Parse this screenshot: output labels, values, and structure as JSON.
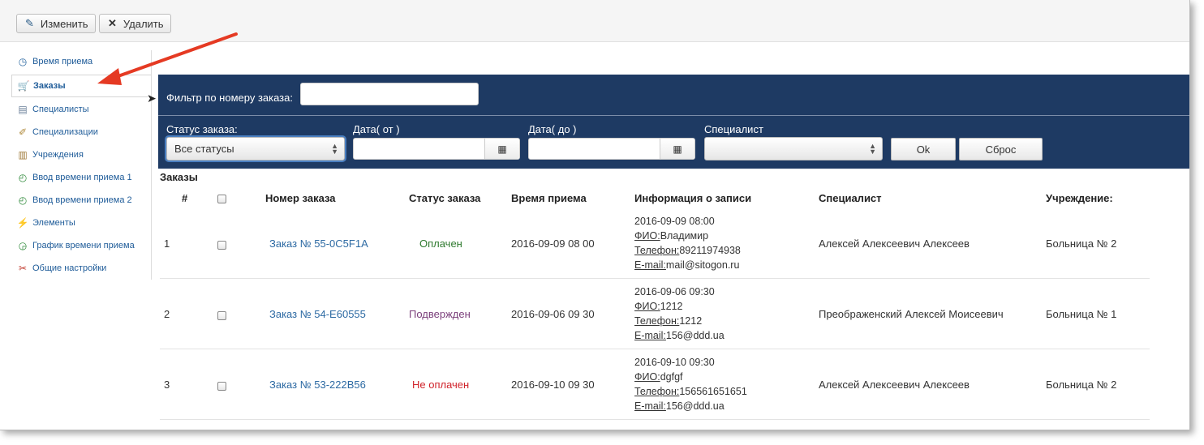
{
  "toolbar": {
    "edit_label": "Изменить",
    "delete_label": "Удалить"
  },
  "sidebar": {
    "items": [
      {
        "label": "Время приема",
        "icon": "clock-icon"
      },
      {
        "label": "Заказы",
        "icon": "cart-icon",
        "active": true
      },
      {
        "label": "Специалисты",
        "icon": "id-card-icon"
      },
      {
        "label": "Специализации",
        "icon": "tag-icon"
      },
      {
        "label": "Учреждения",
        "icon": "building-icon"
      },
      {
        "label": "Ввод времени приема 1",
        "icon": "clock-plus-icon"
      },
      {
        "label": "Ввод времени приема 2",
        "icon": "clock-plus-icon"
      },
      {
        "label": "Элементы",
        "icon": "plug-icon"
      },
      {
        "label": "График времени приема",
        "icon": "clock-chart-icon"
      },
      {
        "label": "Общие настройки",
        "icon": "tools-icon"
      }
    ]
  },
  "filter": {
    "order_number_label": "Фильтр по номеру заказа:",
    "order_number_value": "",
    "status_label": "Статус заказа:",
    "status_value": "Все статусы",
    "date_from_label": "Дата( от )",
    "date_to_label": "Дата( до )",
    "specialist_label": "Специалист",
    "specialist_value": "",
    "ok_label": "Ok",
    "reset_label": "Сброс"
  },
  "table": {
    "title": "Заказы",
    "headers": {
      "num": "#",
      "order": "Номер заказа",
      "status": "Статус заказа",
      "time": "Время приема",
      "info": "Информация о записи",
      "specialist": "Специалист",
      "institution": "Учреждение:"
    },
    "rows": [
      {
        "num": "1",
        "order": "Заказ № 55-0C5F1A",
        "status": "Оплачен",
        "time": "2016-09-09 08 00",
        "info_date": "2016-09-09 08:00",
        "fio_label": "ФИО:",
        "fio": "Владимир",
        "phone_label": "Телефон:",
        "phone": "89211974938",
        "email_label": "E-mail:",
        "email": "mail@sitogon.ru",
        "specialist": "Алексей Алексеевич Алексеев",
        "institution": "Больница № 2"
      },
      {
        "num": "2",
        "order": "Заказ № 54-E60555",
        "status": "Подвержден",
        "time": "2016-09-06 09 30",
        "info_date": "2016-09-06 09:30",
        "fio_label": "ФИО:",
        "fio": "1212",
        "phone_label": "Телефон:",
        "phone": "1212",
        "email_label": "E-mail:",
        "email": "156@ddd.ua",
        "specialist": "Преображенский Алексей Моисеевич",
        "institution": "Больница № 1"
      },
      {
        "num": "3",
        "order": "Заказ № 53-222B56",
        "status": "Не оплачен",
        "time": "2016-09-10 09 30",
        "info_date": "2016-09-10 09:30",
        "fio_label": "ФИО:",
        "fio": "dgfgf",
        "phone_label": "Телефон:",
        "phone": "156561651651",
        "email_label": "E-mail:",
        "email": "156@ddd.ua",
        "specialist": "Алексей Алексеевич Алексеев",
        "institution": "Больница № 2"
      }
    ]
  },
  "colors": {
    "filter_bg": "#1e3a63",
    "link": "#2d6aa3",
    "paid": "#2f7a2f",
    "confirmed": "#7b3f7b",
    "unpaid": "#d0232b",
    "arrow": "#e53a23"
  }
}
